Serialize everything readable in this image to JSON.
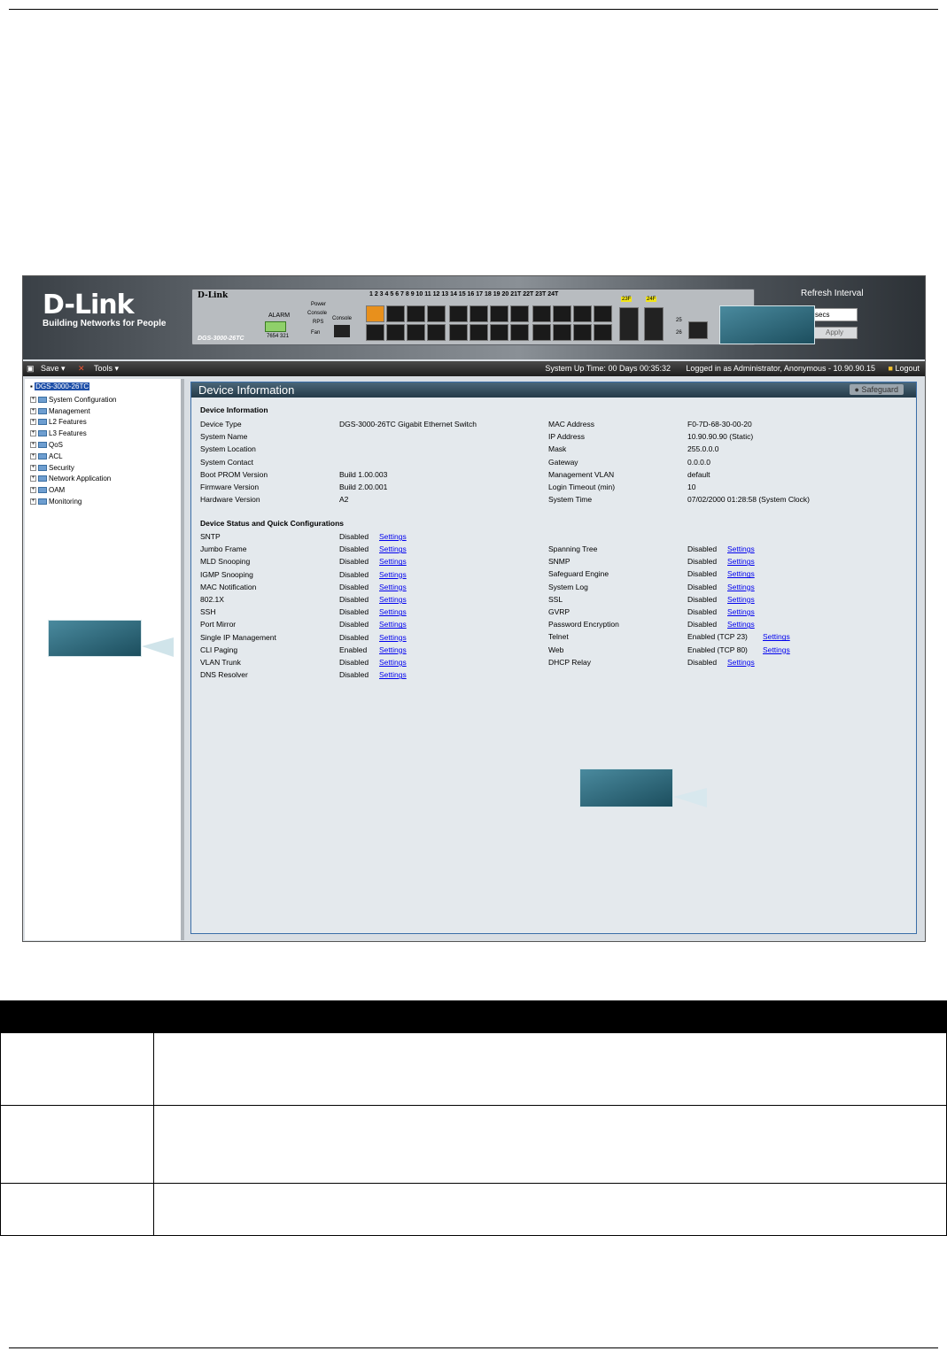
{
  "banner": {
    "brand": "D-Link",
    "tagline": "Building Networks for People",
    "panel_brand": "D-Link",
    "model": "DGS-3000-26TC",
    "alarm_label": "ALARM",
    "alarm_numbers": "7654  321",
    "led_labels": [
      "Power",
      "Console",
      "RPS",
      "Fan",
      "Console"
    ],
    "port_labels_row": "1 2 3 4 5 6 7 8   9 10 11 12 13 14 15 16   17 18 19 20 21T 22T 23T 24T",
    "sfp_labels": [
      "23F",
      "24F",
      "25",
      "26"
    ],
    "refresh_label": "Refresh Interval",
    "refresh_value": "secs",
    "apply_label": "Apply"
  },
  "toolbar": {
    "save_label": "Save",
    "tools_label": "Tools",
    "uptime": "System Up Time: 00 Days 00:35:32",
    "logged_in": "Logged in as Administrator, Anonymous - 10.90.90.15",
    "logout_label": "Logout"
  },
  "tree": {
    "root": "DGS-3000-26TC",
    "items": [
      "System Configuration",
      "Management",
      "L2 Features",
      "L3 Features",
      "QoS",
      "ACL",
      "Security",
      "Network Application",
      "OAM",
      "Monitoring"
    ]
  },
  "content": {
    "title": "Device Information",
    "safeguard": "Safeguard",
    "info_title": "Device Information",
    "info_left": [
      {
        "label": "Device Type",
        "value": "DGS-3000-26TC Gigabit Ethernet Switch"
      },
      {
        "label": "System Name",
        "value": ""
      },
      {
        "label": "System Location",
        "value": ""
      },
      {
        "label": "System Contact",
        "value": ""
      },
      {
        "label": "Boot PROM Version",
        "value": "Build 1.00.003"
      },
      {
        "label": "Firmware Version",
        "value": "Build 2.00.001"
      },
      {
        "label": "Hardware Version",
        "value": "A2"
      }
    ],
    "info_right": [
      {
        "label": "MAC Address",
        "value": "F0-7D-68-30-00-20"
      },
      {
        "label": "IP Address",
        "value": "10.90.90.90 (Static)"
      },
      {
        "label": "Mask",
        "value": "255.0.0.0"
      },
      {
        "label": "Gateway",
        "value": "0.0.0.0"
      },
      {
        "label": "Management VLAN",
        "value": "default"
      },
      {
        "label": "Login Timeout (min)",
        "value": "10"
      },
      {
        "label": "System Time",
        "value": "07/02/2000 01:28:58 (System Clock)"
      }
    ],
    "status_title": "Device Status and Quick Configurations",
    "settings_label": "Settings",
    "status_left": [
      {
        "label": "SNTP",
        "value": "Disabled"
      },
      {
        "label": "Jumbo Frame",
        "value": "Disabled"
      },
      {
        "label": "MLD Snooping",
        "value": "Disabled"
      },
      {
        "label": "IGMP Snooping",
        "value": "Disabled"
      },
      {
        "label": "MAC Notification",
        "value": "Disabled"
      },
      {
        "label": "802.1X",
        "value": "Disabled"
      },
      {
        "label": "SSH",
        "value": "Disabled"
      },
      {
        "label": "Port Mirror",
        "value": "Disabled"
      },
      {
        "label": "Single IP Management",
        "value": "Disabled"
      },
      {
        "label": "CLI Paging",
        "value": "Enabled"
      },
      {
        "label": "VLAN Trunk",
        "value": "Disabled"
      },
      {
        "label": "DNS Resolver",
        "value": "Disabled"
      }
    ],
    "status_right": [
      {
        "label": "Spanning Tree",
        "value": "Disabled"
      },
      {
        "label": "SNMP",
        "value": "Disabled"
      },
      {
        "label": "Safeguard Engine",
        "value": "Disabled"
      },
      {
        "label": "System Log",
        "value": "Disabled"
      },
      {
        "label": "SSL",
        "value": "Disabled"
      },
      {
        "label": "GVRP",
        "value": "Disabled"
      },
      {
        "label": "Password Encryption",
        "value": "Disabled"
      },
      {
        "label": "Telnet",
        "value": "Enabled   (TCP 23)"
      },
      {
        "label": "Web",
        "value": "Enabled   (TCP 80)"
      },
      {
        "label": "DHCP Relay",
        "value": "Disabled"
      }
    ]
  },
  "colors": {
    "accent": "#1e4fa8",
    "link": "#0000ee",
    "callout": "#2a6a7e"
  }
}
